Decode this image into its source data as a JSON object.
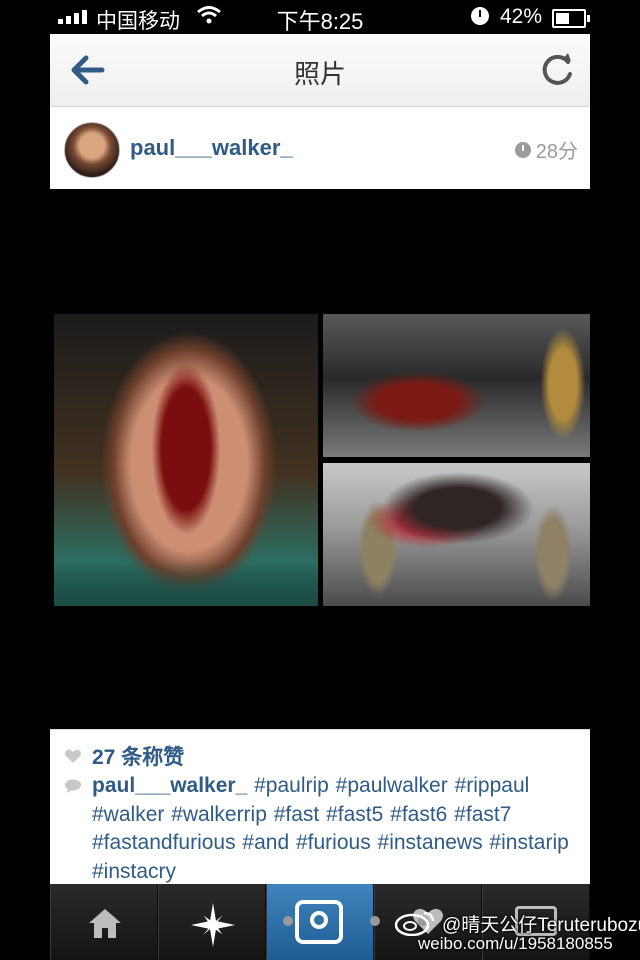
{
  "status_bar": {
    "carrier": "中国移动",
    "time": "下午8:25",
    "battery_percent": "42%",
    "battery_level": 0.42,
    "signal_bars": 4
  },
  "header": {
    "title": "照片",
    "back_icon": "back-arrow-icon",
    "refresh_icon": "refresh-icon"
  },
  "post": {
    "username": "paul___walker_",
    "time_ago": "28分",
    "likes": "27 条称赞",
    "caption_user": "paul___walker_",
    "caption_tags": "#paulrip #paulwalker #rippaul #walker #walkerrip #fast #fast5 #fast6 #fast7 #fastandfurious #and #furious #instanews #instarip #instacry"
  },
  "bottom_nav": {
    "items": [
      {
        "icon": "home-icon",
        "active": false
      },
      {
        "icon": "explore-star-icon",
        "active": false
      },
      {
        "icon": "camera-icon",
        "active": true
      },
      {
        "icon": "heart-nav-icon",
        "active": false
      },
      {
        "icon": "profile-icon",
        "active": false
      }
    ]
  },
  "watermark": {
    "line1": "@晴天公仔Teruterubozu",
    "line2": "weibo.com/u/1958180855"
  },
  "colors": {
    "link_blue": "#2f5b86",
    "active_tab": "#2e73ad",
    "meta_gray": "#9b9b9b"
  }
}
